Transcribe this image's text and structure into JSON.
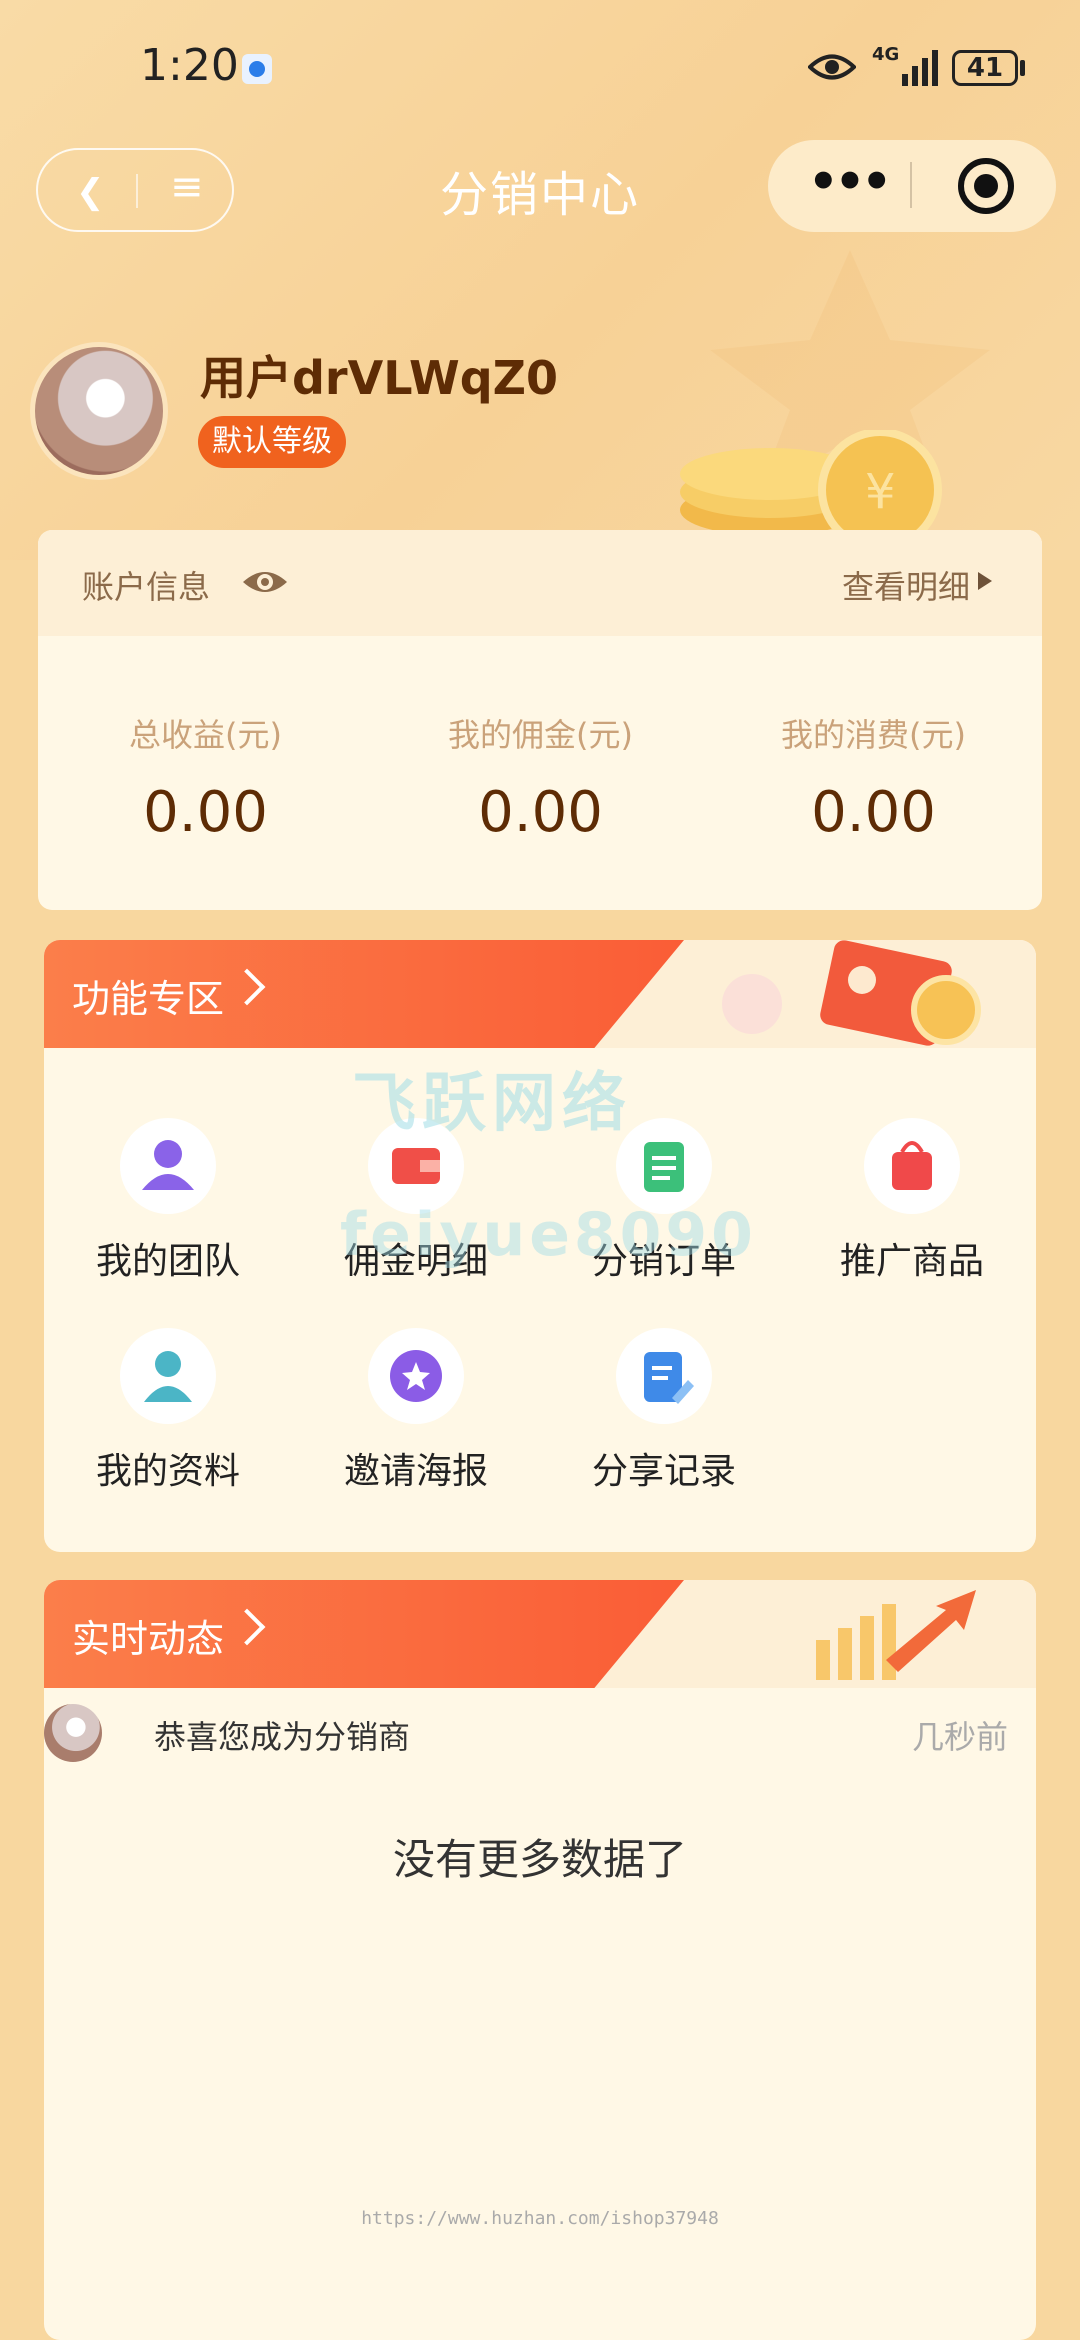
{
  "status_bar": {
    "time": "1:20",
    "network": "4G",
    "battery": "41"
  },
  "nav": {
    "title": "分销中心",
    "back_icon": "chevron-left-icon",
    "menu_icon": "menu-icon",
    "more_icon": "more-dots-icon",
    "close_icon": "target-icon"
  },
  "profile": {
    "username": "用户drVLWqZ0",
    "level": "默认等级"
  },
  "account": {
    "title": "账户信息",
    "detail_link": "查看明细",
    "stats": [
      {
        "label": "总收益(元)",
        "value": "0.00"
      },
      {
        "label": "我的佣金(元)",
        "value": "0.00"
      },
      {
        "label": "我的消费(元)",
        "value": "0.00"
      }
    ]
  },
  "features": {
    "title": "功能专区",
    "items": [
      {
        "label": "我的团队",
        "icon": "team-icon",
        "color": "#8a63e8"
      },
      {
        "label": "佣金明细",
        "icon": "wallet-icon",
        "color": "#f04f48"
      },
      {
        "label": "分销订单",
        "icon": "clipboard-icon",
        "color": "#3cc07a"
      },
      {
        "label": "推广商品",
        "icon": "shopping-bag-icon",
        "color": "#f0494a"
      },
      {
        "label": "我的资料",
        "icon": "user-profile-icon",
        "color": "#4bb5c6"
      },
      {
        "label": "邀请海报",
        "icon": "star-badge-icon",
        "color": "#8b5ce6"
      },
      {
        "label": "分享记录",
        "icon": "document-edit-icon",
        "color": "#3f8ae8"
      }
    ]
  },
  "watermark": {
    "line1": "飞跃网络",
    "line2": "feiyue8090"
  },
  "realtime": {
    "title": "实时动态",
    "items": [
      {
        "text": "恭喜您成为分销商",
        "time": "几秒前"
      }
    ],
    "empty_text": "没有更多数据了"
  },
  "footer_url": "https://www.huzhan.com/ishop37948"
}
